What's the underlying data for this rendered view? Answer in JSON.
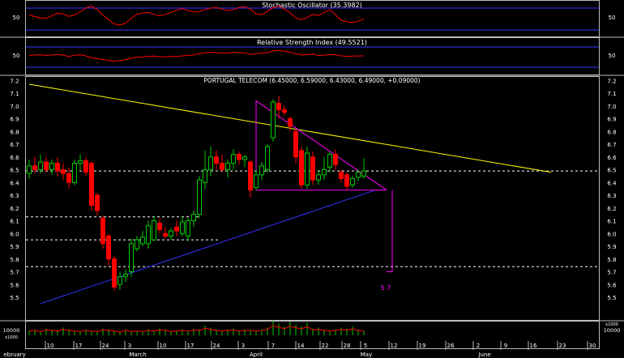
{
  "panels": {
    "stochastic": {
      "title": "Stochastic Oscillator (35.3982)",
      "ticks": [
        "50"
      ],
      "value": 35.3982
    },
    "rsi": {
      "title": "Relative Strength Index (49.5521)",
      "ticks": [
        "50"
      ],
      "value": 49.5521
    },
    "price": {
      "title": "PORTUGAL TELECOM (6.45000, 6.59000, 6.43000, 6.49000, +0.09000)",
      "ticks": [
        "7.2",
        "7.1",
        "7.0",
        "6.9",
        "6.8",
        "6.7",
        "6.6",
        "6.5",
        "6.4",
        "6.3",
        "6.2",
        "6.1",
        "6.0",
        "5.9",
        "5.8",
        "5.7",
        "5.6",
        "5.5"
      ],
      "ylim": [
        5.4,
        7.2
      ],
      "target_label": "5.7"
    },
    "volume": {
      "ticks": [
        "10000",
        "x1000"
      ]
    }
  },
  "x_axis": {
    "day_labels": [
      "10",
      "17",
      "24",
      "3",
      "10",
      "17",
      "24",
      "3",
      "7",
      "14",
      "22",
      "28",
      "5",
      "12",
      "19",
      "26",
      "2",
      "9",
      "16",
      "23",
      "30"
    ],
    "month_labels": [
      "ebruary",
      "March",
      "April",
      "May",
      "June"
    ]
  },
  "chart_data": {
    "type": "candlestick",
    "title": "PORTUGAL TELECOM (6.45000, 6.59000, 6.43000, 6.49000, +0.09000)",
    "ylim": [
      5.4,
      7.2
    ],
    "last": {
      "open": 6.45,
      "high": 6.59,
      "low": 6.43,
      "close": 6.49,
      "change": 0.09
    },
    "candles": [
      {
        "o": 6.47,
        "h": 6.58,
        "l": 6.43,
        "c": 6.53
      },
      {
        "o": 6.53,
        "h": 6.6,
        "l": 6.47,
        "c": 6.5
      },
      {
        "o": 6.5,
        "h": 6.62,
        "l": 6.47,
        "c": 6.56
      },
      {
        "o": 6.56,
        "h": 6.6,
        "l": 6.48,
        "c": 6.5
      },
      {
        "o": 6.5,
        "h": 6.58,
        "l": 6.46,
        "c": 6.55
      },
      {
        "o": 6.55,
        "h": 6.6,
        "l": 6.45,
        "c": 6.49
      },
      {
        "o": 6.5,
        "h": 6.55,
        "l": 6.42,
        "c": 6.47
      },
      {
        "o": 6.47,
        "h": 6.52,
        "l": 6.35,
        "c": 6.4
      },
      {
        "o": 6.4,
        "h": 6.58,
        "l": 6.38,
        "c": 6.55
      },
      {
        "o": 6.55,
        "h": 6.62,
        "l": 6.5,
        "c": 6.57
      },
      {
        "o": 6.57,
        "h": 6.6,
        "l": 6.45,
        "c": 6.48
      },
      {
        "o": 6.55,
        "h": 6.56,
        "l": 6.18,
        "c": 6.22
      },
      {
        "o": 6.3,
        "h": 6.32,
        "l": 6.14,
        "c": 6.18
      },
      {
        "o": 6.12,
        "h": 6.14,
        "l": 5.88,
        "c": 5.92
      },
      {
        "o": 5.98,
        "h": 6.0,
        "l": 5.75,
        "c": 5.8
      },
      {
        "o": 5.8,
        "h": 5.82,
        "l": 5.55,
        "c": 5.58
      },
      {
        "o": 5.6,
        "h": 5.7,
        "l": 5.56,
        "c": 5.66
      },
      {
        "o": 5.66,
        "h": 5.72,
        "l": 5.62,
        "c": 5.68
      },
      {
        "o": 5.7,
        "h": 5.96,
        "l": 5.66,
        "c": 5.92
      },
      {
        "o": 5.88,
        "h": 5.98,
        "l": 5.86,
        "c": 5.95
      },
      {
        "o": 5.92,
        "h": 6.02,
        "l": 5.9,
        "c": 5.97
      },
      {
        "o": 5.92,
        "h": 6.1,
        "l": 5.88,
        "c": 6.06
      },
      {
        "o": 5.95,
        "h": 6.14,
        "l": 5.94,
        "c": 6.1
      },
      {
        "o": 6.08,
        "h": 6.12,
        "l": 6.0,
        "c": 6.03
      },
      {
        "o": 6.0,
        "h": 6.05,
        "l": 5.96,
        "c": 5.98
      },
      {
        "o": 5.98,
        "h": 6.04,
        "l": 5.95,
        "c": 6.02
      },
      {
        "o": 6.05,
        "h": 6.1,
        "l": 5.98,
        "c": 6.02
      },
      {
        "o": 6.0,
        "h": 6.14,
        "l": 5.98,
        "c": 6.09
      },
      {
        "o": 5.98,
        "h": 6.12,
        "l": 5.94,
        "c": 6.1
      },
      {
        "o": 6.1,
        "h": 6.18,
        "l": 6.05,
        "c": 6.15
      },
      {
        "o": 6.15,
        "h": 6.45,
        "l": 6.12,
        "c": 6.42
      },
      {
        "o": 6.4,
        "h": 6.65,
        "l": 6.35,
        "c": 6.5
      },
      {
        "o": 6.5,
        "h": 6.68,
        "l": 6.45,
        "c": 6.6
      },
      {
        "o": 6.6,
        "h": 6.65,
        "l": 6.5,
        "c": 6.55
      },
      {
        "o": 6.55,
        "h": 6.62,
        "l": 6.48,
        "c": 6.5
      },
      {
        "o": 6.5,
        "h": 6.58,
        "l": 6.44,
        "c": 6.55
      },
      {
        "o": 6.55,
        "h": 6.66,
        "l": 6.5,
        "c": 6.62
      },
      {
        "o": 6.62,
        "h": 6.64,
        "l": 6.54,
        "c": 6.58
      },
      {
        "o": 6.58,
        "h": 6.62,
        "l": 6.52,
        "c": 6.6
      },
      {
        "o": 6.56,
        "h": 6.58,
        "l": 6.28,
        "c": 6.34
      },
      {
        "o": 6.36,
        "h": 6.5,
        "l": 6.34,
        "c": 6.46
      },
      {
        "o": 6.46,
        "h": 6.56,
        "l": 6.42,
        "c": 6.53
      },
      {
        "o": 6.5,
        "h": 6.7,
        "l": 6.48,
        "c": 6.68
      },
      {
        "o": 6.75,
        "h": 7.05,
        "l": 6.72,
        "c": 7.03
      },
      {
        "o": 7.02,
        "h": 7.08,
        "l": 6.9,
        "c": 6.97
      },
      {
        "o": 6.97,
        "h": 7.0,
        "l": 6.92,
        "c": 6.95
      },
      {
        "o": 6.9,
        "h": 6.92,
        "l": 6.8,
        "c": 6.84
      },
      {
        "o": 6.8,
        "h": 6.82,
        "l": 6.55,
        "c": 6.6
      },
      {
        "o": 6.65,
        "h": 6.68,
        "l": 6.35,
        "c": 6.38
      },
      {
        "o": 6.38,
        "h": 6.68,
        "l": 6.35,
        "c": 6.63
      },
      {
        "o": 6.6,
        "h": 6.64,
        "l": 6.38,
        "c": 6.42
      },
      {
        "o": 6.42,
        "h": 6.5,
        "l": 6.38,
        "c": 6.46
      },
      {
        "o": 6.46,
        "h": 6.6,
        "l": 6.42,
        "c": 6.5
      },
      {
        "o": 6.52,
        "h": 6.64,
        "l": 6.48,
        "c": 6.62
      },
      {
        "o": 6.62,
        "h": 6.66,
        "l": 6.5,
        "c": 6.54
      },
      {
        "o": 6.48,
        "h": 6.5,
        "l": 6.4,
        "c": 6.43
      },
      {
        "o": 6.46,
        "h": 6.48,
        "l": 6.34,
        "c": 6.37
      },
      {
        "o": 6.38,
        "h": 6.45,
        "l": 6.36,
        "c": 6.43
      },
      {
        "o": 6.44,
        "h": 6.5,
        "l": 6.41,
        "c": 6.48
      },
      {
        "o": 6.45,
        "h": 6.59,
        "l": 6.43,
        "c": 6.49
      }
    ],
    "volume": [
      5,
      6,
      4,
      7,
      6,
      5,
      8,
      6,
      5,
      4,
      6,
      5,
      4,
      7,
      6,
      5,
      3,
      6,
      4,
      5,
      4,
      6,
      5,
      7,
      6,
      4,
      5,
      6,
      5,
      7,
      6,
      10,
      8,
      6,
      5,
      6,
      7,
      5,
      6,
      6,
      5,
      6,
      8,
      15,
      12,
      9,
      14,
      11,
      9,
      13,
      7,
      8,
      6,
      5,
      6,
      8,
      7,
      9,
      6,
      5
    ],
    "stochastic": [
      62,
      55,
      50,
      48,
      58,
      70,
      66,
      56,
      62,
      75,
      90,
      98,
      84,
      60,
      42,
      25,
      20,
      28,
      48,
      64,
      70,
      72,
      64,
      58,
      64,
      72,
      82,
      88,
      80,
      74,
      76,
      84,
      90,
      92,
      86,
      80,
      84,
      92,
      96,
      86,
      66,
      62,
      78,
      92,
      98,
      86,
      70,
      50,
      42,
      52,
      64,
      60,
      72,
      84,
      62,
      40,
      34,
      30,
      36,
      46
    ],
    "rsi": [
      52,
      54,
      55,
      52,
      54,
      56,
      53,
      48,
      52,
      55,
      50,
      42,
      38,
      34,
      30,
      26,
      30,
      33,
      40,
      44,
      45,
      48,
      49,
      46,
      46,
      48,
      47,
      50,
      52,
      54,
      60,
      64,
      66,
      64,
      62,
      62,
      66,
      64,
      64,
      56,
      60,
      62,
      64,
      72,
      74,
      70,
      66,
      60,
      54,
      56,
      58,
      52,
      53,
      56,
      55,
      50,
      48,
      49,
      50,
      50
    ],
    "target": 5.7,
    "trendlines": [
      {
        "color": "#ffff00",
        "from": {
          "i": 0,
          "v": 7.17
        },
        "to": {
          "i": 92,
          "v": 6.48
        }
      },
      {
        "color": "#3333ff",
        "from": {
          "i": 2,
          "v": 5.45
        },
        "to": {
          "i": 61,
          "v": 6.34
        }
      },
      {
        "color": "#ff00ff",
        "from": {
          "i": 40,
          "v": 7.04
        },
        "to": {
          "i": 63,
          "v": 6.34
        }
      },
      {
        "color": "#ff00ff",
        "from": {
          "i": 40,
          "v": 6.34
        },
        "to": {
          "i": 63,
          "v": 6.34
        }
      },
      {
        "color": "#ff00ff",
        "from": {
          "i": 40,
          "v": 7.04
        },
        "to": {
          "i": 40,
          "v": 6.34
        }
      }
    ],
    "support_levels": [
      6.49,
      6.13,
      5.95,
      5.74
    ],
    "colors": {
      "up": "#00cc00",
      "down": "#ff0000",
      "stoch": "#ff0000",
      "rsi": "#ff0000",
      "band": "#3333ff",
      "grid": "#ffffff",
      "yellow": "#ffff00",
      "magenta": "#ff00ff"
    }
  }
}
